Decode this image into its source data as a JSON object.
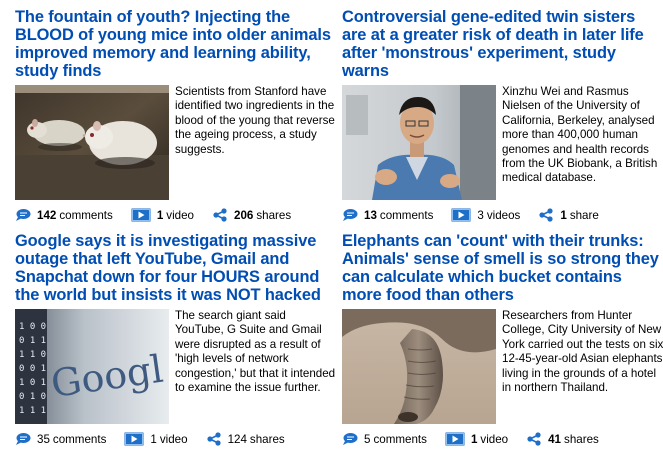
{
  "articles": [
    {
      "headline": "The fountain of youth? Injecting the BLOOD of young mice into older animals improved memory and learning ability, study finds",
      "summary": "Scientists from Stanford have identified two ingredients in the blood of the young that reverse the ageing process, a study suggests.",
      "comments_count": "142",
      "comments_label": "comments",
      "video_count": "1",
      "video_label": "video",
      "shares_count": "206",
      "shares_label": "shares"
    },
    {
      "headline": "Controversial gene-edited twin sisters are at a greater risk of death in later life after 'monstrous' experiment, study warns",
      "summary": "Xinzhu Wei and Rasmus Nielsen of the University of California, Berkeley, analysed more than 400,000 human genomes and health records from the UK Biobank, a British medical database.",
      "comments_count": "13",
      "comments_label": "comments",
      "video_count": "3",
      "video_label": "videos",
      "shares_count": "1",
      "shares_label": "share"
    },
    {
      "headline": "Google says it is investigating massive outage that left YouTube, Gmail and Snapchat down for four HOURS around the world but insists it was NOT hacked",
      "summary": "The search giant said YouTube, G Suite and Gmail were disrupted as a result of 'high levels of network congestion,' but that it intended to examine the issue further.",
      "comments_count": "35",
      "comments_label": "comments",
      "video_count": "1",
      "video_label": "video",
      "shares_count": "124",
      "shares_label": "shares",
      "image_text": "Googl"
    },
    {
      "headline": "Elephants can 'count' with their trunks: Animals' sense of smell is so strong they can calculate which bucket contains more food than others",
      "summary": "Researchers from Hunter College, City University of New York carried out the tests on six 12-45-year-old Asian elephants living in the grounds of a hotel in northern Thailand.",
      "comments_count": "5",
      "comments_label": "comments",
      "video_count": "1",
      "video_label": "video",
      "shares_count": "41",
      "shares_label": "shares"
    }
  ],
  "colors": {
    "headline": "#004db3",
    "icon": "#1f6fc9",
    "text": "#000000"
  },
  "icons": {
    "comments": "speech-bubble-icon",
    "video": "play-video-icon",
    "share": "share-icon"
  }
}
